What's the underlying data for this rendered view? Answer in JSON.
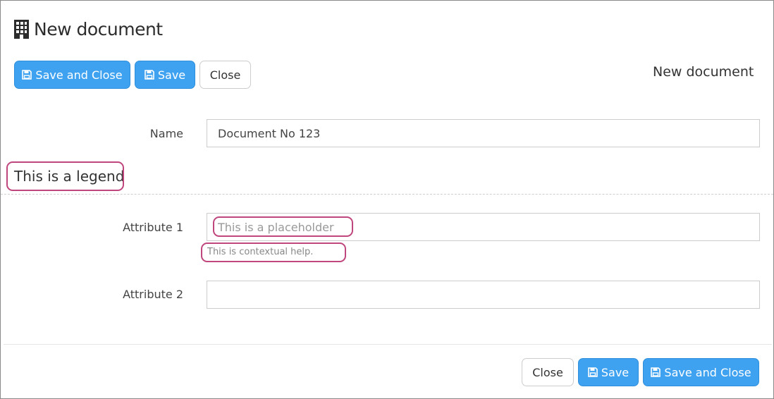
{
  "window": {
    "title": "New document",
    "title_icon": "building-icon"
  },
  "toolbar_top": {
    "save_and_close_label": "Save and Close",
    "save_label": "Save",
    "close_label": "Close",
    "save_icon": "floppy-disk-icon"
  },
  "header_right_title": "New document",
  "form": {
    "name": {
      "label": "Name",
      "value": "Document No 123"
    },
    "legend": "This is a legend",
    "attribute1": {
      "label": "Attribute 1",
      "placeholder": "This is a placeholder",
      "value": "",
      "help": "This is contextual help."
    },
    "attribute2": {
      "label": "Attribute 2",
      "value": ""
    }
  },
  "toolbar_bottom": {
    "close_label": "Close",
    "save_label": "Save",
    "save_and_close_label": "Save and Close"
  },
  "colors": {
    "primary_button": "#3fa2f0",
    "annotation_outline": "#c0467e"
  }
}
